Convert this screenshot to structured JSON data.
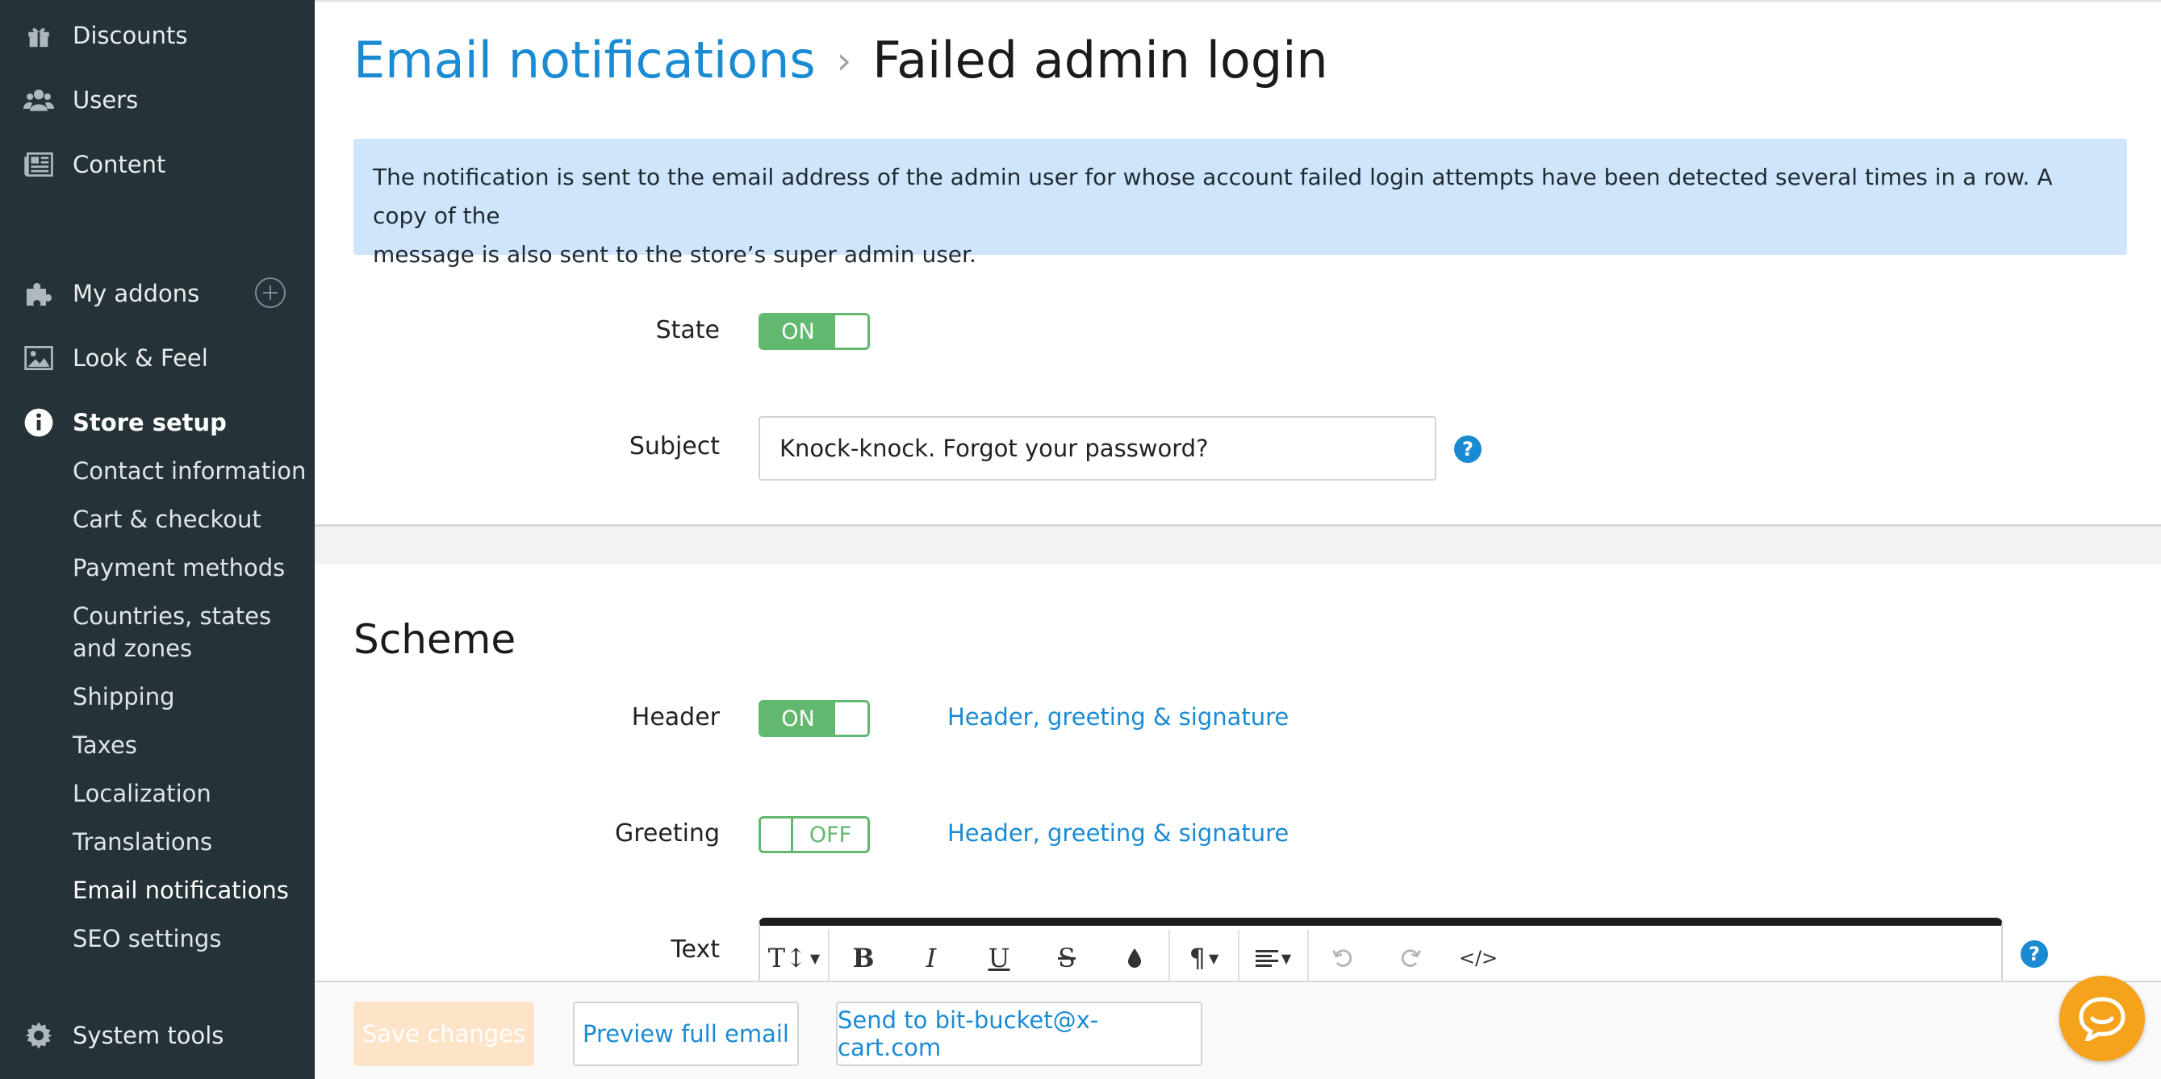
{
  "sidebar": {
    "items": [
      {
        "label": "Discounts",
        "icon": "gift-icon"
      },
      {
        "label": "Users",
        "icon": "users-icon"
      },
      {
        "label": "Content",
        "icon": "newspaper-icon"
      },
      {
        "label": "My addons",
        "icon": "puzzle-icon"
      },
      {
        "label": "Look & Feel",
        "icon": "image-icon"
      },
      {
        "label": "Store setup",
        "icon": "info-icon"
      },
      {
        "label": "System tools",
        "icon": "gear-icon"
      }
    ],
    "store_setup_subitems": [
      "Contact information",
      "Cart & checkout",
      "Payment methods",
      "Countries, states",
      "and zones",
      "Shipping",
      "Taxes",
      "Localization",
      "Translations",
      "Email notifications",
      "SEO settings"
    ]
  },
  "breadcrumb": {
    "parent": "Email notifications",
    "separator": "›",
    "current": "Failed admin login"
  },
  "info": {
    "line1": "The notification is sent to the email address of the admin user for whose account failed login attempts have been detected several times in a row. A copy of the",
    "line2": "message is also sent to the store’s super admin user."
  },
  "form": {
    "state_label": "State",
    "state_value": "ON",
    "subject_label": "Subject",
    "subject_value": "Knock-knock. Forgot your password?",
    "help": "?"
  },
  "scheme": {
    "title": "Scheme",
    "header_label": "Header",
    "header_value": "ON",
    "header_link": "Header, greeting & signature",
    "greeting_label": "Greeting",
    "greeting_value": "OFF",
    "greeting_link": "Header, greeting & signature",
    "text_label": "Text"
  },
  "editor_toolbar": {
    "font_size": "T↕",
    "bold": "B",
    "italic": "I",
    "underline": "U",
    "strike": "S",
    "paragraph": "¶",
    "code": "</>"
  },
  "footer": {
    "save": "Save changes",
    "preview": "Preview full email",
    "send": "Send to bit-bucket@x-cart.com"
  },
  "colors": {
    "sidebar_bg": "#253238",
    "accent": "#1a8bd3",
    "toggle_green": "#62b86e",
    "info_bg": "#cfe5fb",
    "chat_orange": "#f5a21c"
  }
}
